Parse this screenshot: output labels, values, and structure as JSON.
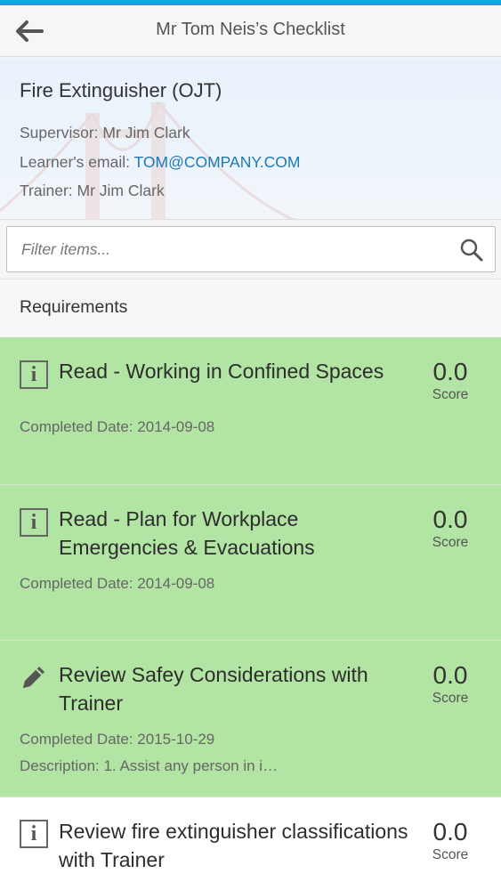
{
  "header": {
    "title": "Mr Tom Neis’s Checklist",
    "back_icon": "arrow-left-icon"
  },
  "checklist": {
    "title": "Fire Extinguisher (OJT)",
    "supervisor_label": "Supervisor:",
    "supervisor_value": "Mr Jim Clark",
    "email_label": "Learner's email:",
    "email_value": "TOM@COMPANY.COM",
    "trainer_label": "Trainer:",
    "trainer_value": "Mr Jim Clark"
  },
  "filter": {
    "placeholder": "Filter items...",
    "value": "",
    "search_icon": "search-icon"
  },
  "section": {
    "title": "Requirements"
  },
  "requirements": [
    {
      "title": "Read - Working in Confined Spaces",
      "score": "0.0",
      "score_label": "Score",
      "completed": "Completed Date: 2014-09-08",
      "description": "",
      "icon": "info-icon",
      "status": "completed"
    },
    {
      "title": "Read - Plan for Workplace Emergencies & Evacuations",
      "score": "0.0",
      "score_label": "Score",
      "completed": "Completed Date: 2014-09-08",
      "description": "",
      "icon": "info-icon",
      "status": "completed"
    },
    {
      "title": "Review Safey Considerations with Trainer",
      "score": "0.0",
      "score_label": "Score",
      "completed": "Completed Date: 2015-10-29",
      "description": "Description: 1. Assist any person in i…",
      "icon": "pencil-icon",
      "status": "completed"
    },
    {
      "title": "Review fire extinguisher classifications with Trainer",
      "score": "0.0",
      "score_label": "Score",
      "completed": "",
      "description": "",
      "icon": "info-icon",
      "status": "pending"
    }
  ],
  "colors": {
    "accent_bar": "#1aa1e1",
    "completed_row": "#b2e4a3",
    "link": "#1b7ab8"
  }
}
